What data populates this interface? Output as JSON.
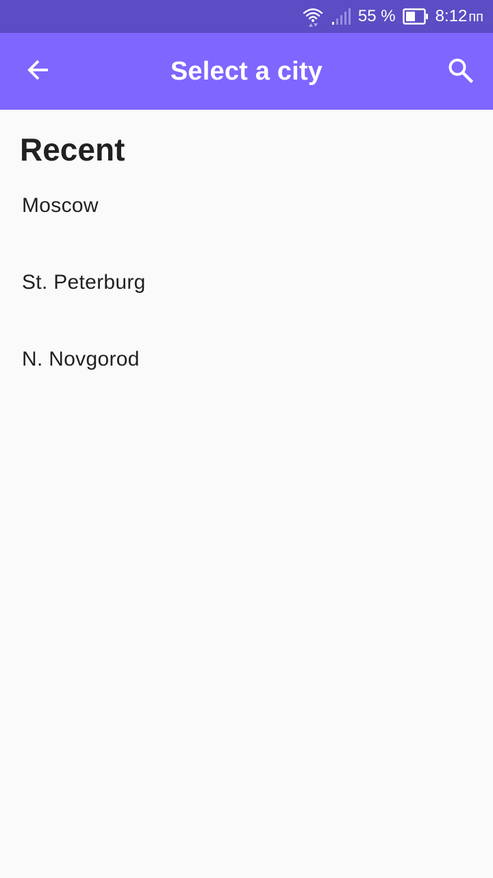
{
  "status_bar": {
    "battery_percent": "55 %",
    "time": "8:12",
    "suffix": "пп",
    "icons": [
      "wifi-icon",
      "signal-icon",
      "battery-icon"
    ],
    "background": "#5b4dc4"
  },
  "app_bar": {
    "title": "Select a city",
    "back_icon": "arrow-left-icon",
    "search_icon": "search-icon",
    "background": "#7e66ff"
  },
  "recent": {
    "heading": "Recent",
    "cities": [
      {
        "label": "Moscow"
      },
      {
        "label": "St. Peterburg"
      },
      {
        "label": "N. Novgorod"
      }
    ]
  }
}
